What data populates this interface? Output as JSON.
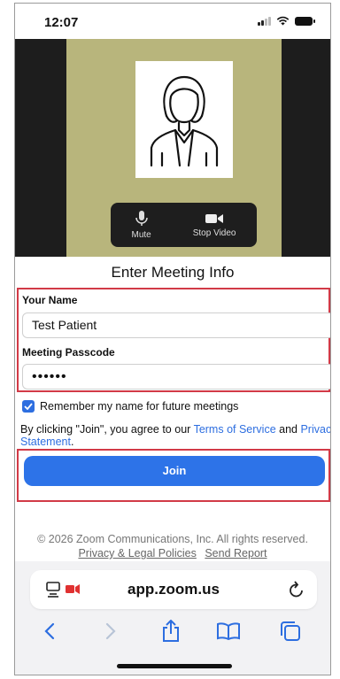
{
  "status_bar": {
    "time": "12:07"
  },
  "video": {
    "controls": [
      {
        "label": "Mute",
        "icon": "microphone-icon"
      },
      {
        "label": "Stop Video",
        "icon": "video-camera-icon"
      }
    ]
  },
  "form": {
    "heading": "Enter Meeting Info",
    "name_label": "Your Name",
    "name_value": "Test Patient",
    "passcode_label": "Meeting Passcode",
    "passcode_value": "••••••",
    "remember_label": "Remember my name for future meetings",
    "remember_checked": true,
    "agree_prefix": "By clicking \"Join\", you agree to our ",
    "terms_link": "Terms of Service",
    "agree_and": " and ",
    "privacy_link": "Privacy Statement",
    "agree_suffix": ".",
    "join_label": "Join"
  },
  "footer": {
    "copyright": "© 2026 Zoom Communications, Inc. All rights reserved.",
    "privacy_policies": "Privacy & Legal Policies",
    "send_report": "Send Report"
  },
  "browser": {
    "url": "app.zoom.us",
    "accent": "#2d6ee0",
    "highlight": "#d23a47"
  }
}
